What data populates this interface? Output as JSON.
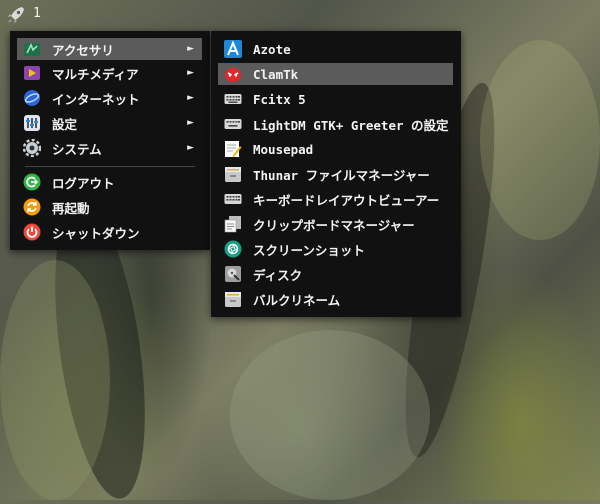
{
  "taskbar": {
    "workspace_number": "1",
    "launcher_icon": "rocket-icon"
  },
  "main_menu": {
    "items": [
      {
        "label": "アクセサリ",
        "icon": "accessories-icon",
        "has_submenu": true,
        "active": true
      },
      {
        "label": "マルチメディア",
        "icon": "multimedia-icon",
        "has_submenu": true
      },
      {
        "label": "インターネット",
        "icon": "internet-icon",
        "has_submenu": true
      },
      {
        "label": "設定",
        "icon": "settings-icon",
        "has_submenu": true
      },
      {
        "label": "システム",
        "icon": "system-gear-icon",
        "has_submenu": true
      }
    ],
    "session": [
      {
        "label": "ログアウト",
        "icon": "logout-icon",
        "color": "#35b24a"
      },
      {
        "label": "再起動",
        "icon": "reboot-icon",
        "color": "#f39c12"
      },
      {
        "label": "シャットダウン",
        "icon": "shutdown-icon",
        "color": "#e74c3c"
      }
    ],
    "submenu_arrow": "►"
  },
  "submenu": {
    "items": [
      {
        "label": "Azote",
        "icon": "azote-icon"
      },
      {
        "label": "ClamTk",
        "icon": "clamtk-icon",
        "active": true
      },
      {
        "label": "Fcitx 5",
        "icon": "keyboard-icon"
      },
      {
        "label": "LightDM GTK+ Greeter の設定",
        "icon": "keyboard-icon"
      },
      {
        "label": "Mousepad",
        "icon": "mousepad-icon"
      },
      {
        "label": "Thunar ファイルマネージャー",
        "icon": "file-manager-icon"
      },
      {
        "label": "キーボードレイアウトビューアー",
        "icon": "keyboard-icon"
      },
      {
        "label": "クリップボードマネージャー",
        "icon": "clipboard-icon"
      },
      {
        "label": "スクリーンショット",
        "icon": "screenshot-icon"
      },
      {
        "label": "ディスク",
        "icon": "disk-icon"
      },
      {
        "label": "バルクリネーム",
        "icon": "bulk-rename-icon"
      }
    ]
  },
  "colors": {
    "menu_bg": "#111111",
    "highlight": "#5b5b5b",
    "text": "#f3f3f3"
  }
}
